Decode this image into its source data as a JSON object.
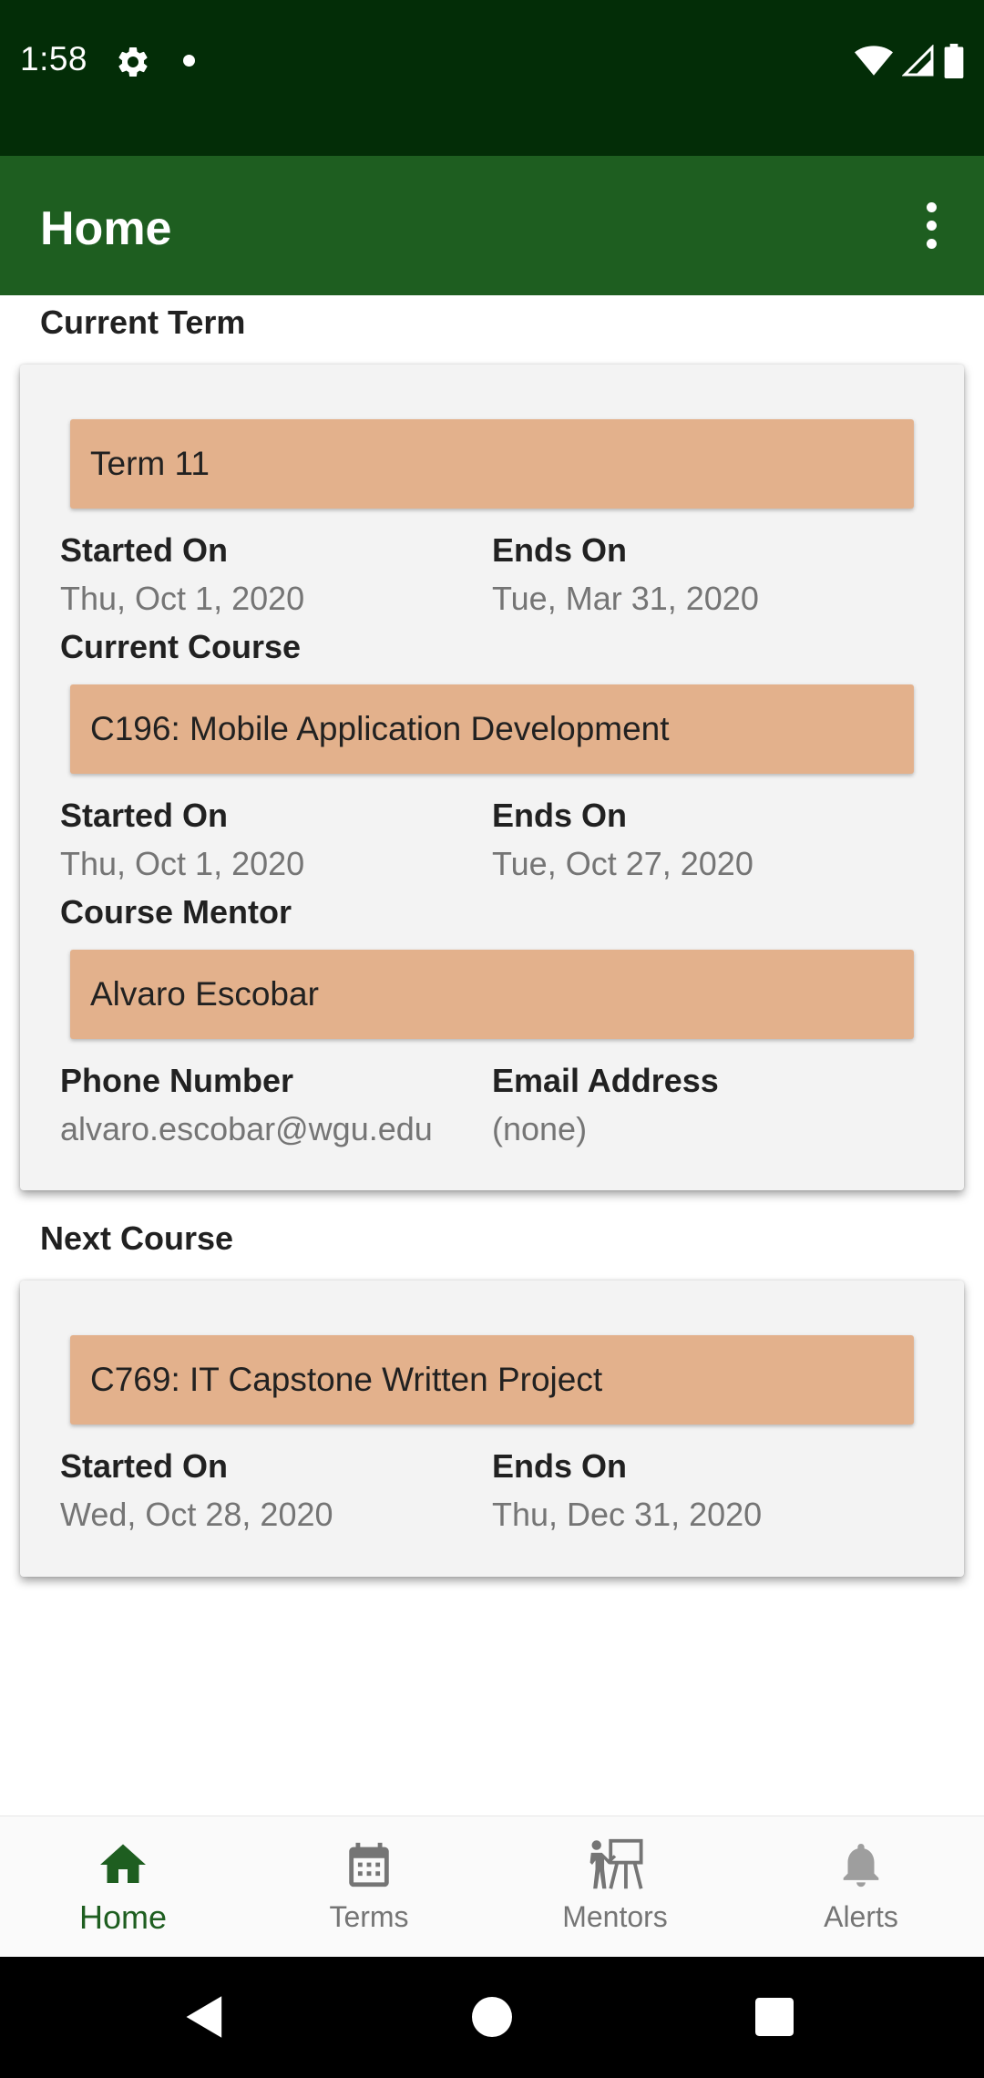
{
  "status": {
    "time": "1:58",
    "icons": [
      "settings-icon",
      "notification-dot-icon",
      "wifi-icon",
      "cellular-icon",
      "battery-icon"
    ]
  },
  "app_bar": {
    "title": "Home",
    "menu_icon": "more-vert-icon"
  },
  "current_term": {
    "section_title": "Current Term",
    "term_name": "Term 11",
    "started_label": "Started On",
    "started_value": "Thu, Oct 1, 2020",
    "ends_label": "Ends On",
    "ends_value": "Tue, Mar 31, 2020",
    "current_course_title": "Current Course",
    "course_name": "C196: Mobile Application Development",
    "course_started_label": "Started On",
    "course_started_value": "Thu, Oct 1, 2020",
    "course_ends_label": "Ends On",
    "course_ends_value": "Tue, Oct 27, 2020",
    "mentor_title": "Course Mentor",
    "mentor_name": "Alvaro Escobar",
    "phone_label": "Phone Number",
    "phone_value": "alvaro.escobar@wgu.edu",
    "email_label": "Email Address",
    "email_value": "(none)"
  },
  "next_course": {
    "section_title": "Next Course",
    "course_name": "C769: IT Capstone Written Project",
    "started_label": "Started On",
    "started_value": "Wed, Oct 28, 2020",
    "ends_label": "Ends On",
    "ends_value": "Thu, Dec 31, 2020"
  },
  "bottom_nav": {
    "items": [
      {
        "label": "Home",
        "icon": "home-icon",
        "active": true
      },
      {
        "label": "Terms",
        "icon": "calendar-icon",
        "active": false
      },
      {
        "label": "Mentors",
        "icon": "mentor-icon",
        "active": false
      },
      {
        "label": "Alerts",
        "icon": "bell-icon",
        "active": false
      }
    ]
  },
  "colors": {
    "status_bar": "#032d07",
    "app_bar": "#1e5e20",
    "pill": "#e3b18c",
    "card": "#f3f3f3",
    "active_nav": "#1e5e20",
    "inactive_nav": "#757575"
  }
}
